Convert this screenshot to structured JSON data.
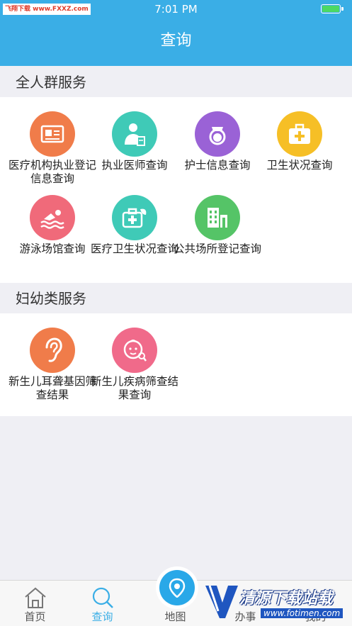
{
  "status": {
    "carrier": "飞翔下载 www.FXXZ.com",
    "time": "7:01 PM",
    "battery_level": 1.0
  },
  "header": {
    "title": "查询"
  },
  "sections": [
    {
      "title": "全人群服务",
      "items": [
        {
          "label": "医疗机构执业登记信息查询",
          "icon": "certificate-icon",
          "color": "#f07c4a"
        },
        {
          "label": "执业医师查询",
          "icon": "doctor-icon",
          "color": "#3fcab7"
        },
        {
          "label": "护士信息查询",
          "icon": "nurse-icon",
          "color": "#9a62d6"
        },
        {
          "label": "卫生状况查询",
          "icon": "first-aid-kit-icon",
          "color": "#f6bf26"
        },
        {
          "label": "游泳场馆查询",
          "icon": "swimming-icon",
          "color": "#f06a7a"
        },
        {
          "label": "医疗卫生状况查询",
          "icon": "medical-bag-icon",
          "color": "#3fcab7"
        },
        {
          "label": "公共场所登记查询",
          "icon": "building-icon",
          "color": "#55c467"
        }
      ]
    },
    {
      "title": "妇幼类服务",
      "items": [
        {
          "label": "新生儿耳聋基因筛查结果",
          "icon": "ear-icon",
          "color": "#f07c4a"
        },
        {
          "label": "新生儿疾病筛查结果查询",
          "icon": "baby-icon",
          "color": "#f06a8a"
        }
      ]
    }
  ],
  "tabbar": {
    "tabs": [
      {
        "label": "首页",
        "icon": "home-icon"
      },
      {
        "label": "查询",
        "icon": "search-icon",
        "active": true
      },
      {
        "label": "地图",
        "icon": "map-pin-icon"
      },
      {
        "label": "办事",
        "icon": "briefcase-icon"
      },
      {
        "label": "我的",
        "icon": "user-icon"
      }
    ]
  },
  "watermark": {
    "title": "清源下载站载",
    "url": "www.fotimen.com"
  },
  "colors": {
    "brand": "#3aaee6",
    "background": "#efeff4",
    "text": "#222222",
    "tab_active": "#3aaee6"
  }
}
